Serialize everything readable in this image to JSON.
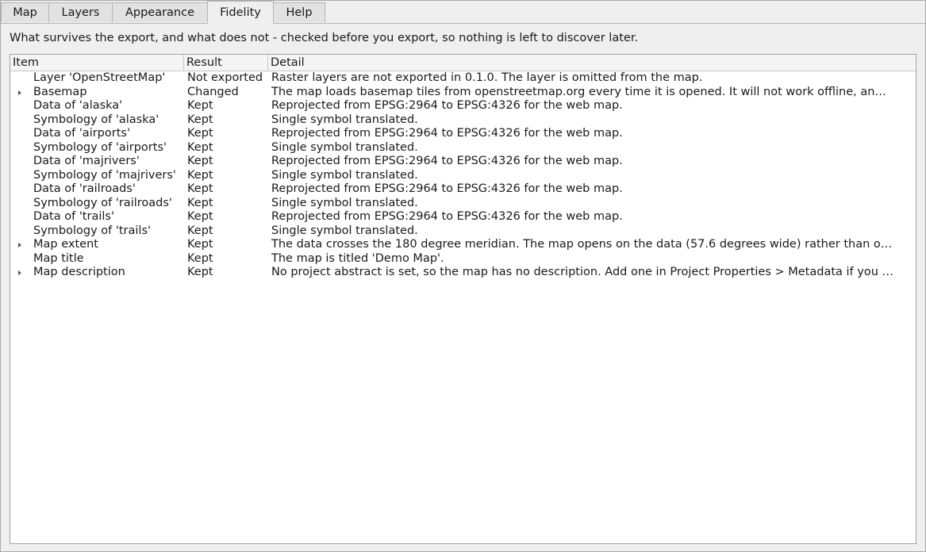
{
  "tabs": [
    {
      "label": "Map"
    },
    {
      "label": "Layers"
    },
    {
      "label": "Appearance"
    },
    {
      "label": "Fidelity"
    },
    {
      "label": "Help"
    }
  ],
  "active_tab": "Fidelity",
  "description": "What survives the export, and what does not - checked before you export, so nothing is left to discover later.",
  "table": {
    "headers": {
      "item": "Item",
      "result": "Result",
      "detail": "Detail"
    },
    "rows": [
      {
        "item": "Layer 'OpenStreetMap'",
        "result": "Not exported",
        "detail": "Raster layers are not exported in 0.1.0. The layer is omitted from the map.",
        "expandable": false
      },
      {
        "item": "Basemap",
        "result": "Changed",
        "detail": "The map loads basemap tiles from openstreetmap.org every time it is opened. It will not work offline, an…",
        "expandable": true
      },
      {
        "item": "Data of 'alaska'",
        "result": "Kept",
        "detail": "Reprojected from EPSG:2964 to EPSG:4326 for the web map.",
        "expandable": false
      },
      {
        "item": "Symbology of 'alaska'",
        "result": "Kept",
        "detail": "Single symbol translated.",
        "expandable": false
      },
      {
        "item": "Data of 'airports'",
        "result": "Kept",
        "detail": "Reprojected from EPSG:2964 to EPSG:4326 for the web map.",
        "expandable": false
      },
      {
        "item": "Symbology of 'airports'",
        "result": "Kept",
        "detail": "Single symbol translated.",
        "expandable": false
      },
      {
        "item": "Data of 'majrivers'",
        "result": "Kept",
        "detail": "Reprojected from EPSG:2964 to EPSG:4326 for the web map.",
        "expandable": false
      },
      {
        "item": "Symbology of 'majrivers'",
        "result": "Kept",
        "detail": "Single symbol translated.",
        "expandable": false
      },
      {
        "item": "Data of 'railroads'",
        "result": "Kept",
        "detail": "Reprojected from EPSG:2964 to EPSG:4326 for the web map.",
        "expandable": false
      },
      {
        "item": "Symbology of 'railroads'",
        "result": "Kept",
        "detail": "Single symbol translated.",
        "expandable": false
      },
      {
        "item": "Data of 'trails'",
        "result": "Kept",
        "detail": "Reprojected from EPSG:2964 to EPSG:4326 for the web map.",
        "expandable": false
      },
      {
        "item": "Symbology of 'trails'",
        "result": "Kept",
        "detail": "Single symbol translated.",
        "expandable": false
      },
      {
        "item": "Map extent",
        "result": "Kept",
        "detail": "The data crosses the 180 degree meridian. The map opens on the data (57.6 degrees wide) rather than o…",
        "expandable": true
      },
      {
        "item": "Map title",
        "result": "Kept",
        "detail": "The map is titled 'Demo Map'.",
        "expandable": false
      },
      {
        "item": "Map description",
        "result": "Kept",
        "detail": "No project abstract is set, so the map has no description. Add one in Project Properties > Metadata if you …",
        "expandable": true
      }
    ]
  }
}
